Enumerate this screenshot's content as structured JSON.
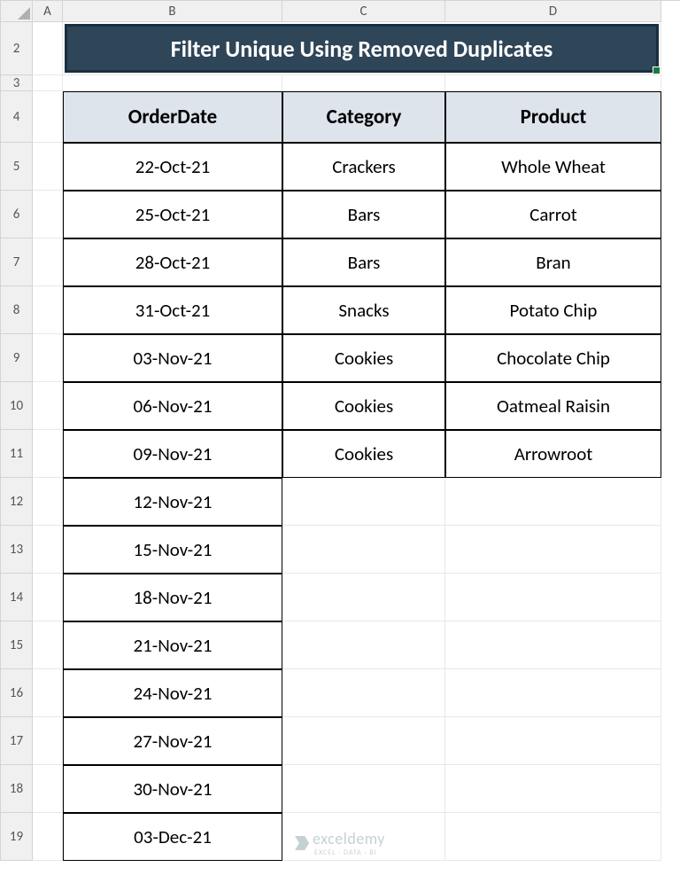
{
  "columns": [
    "A",
    "B",
    "C",
    "D"
  ],
  "rows": [
    "2",
    "3",
    "4",
    "5",
    "6",
    "7",
    "8",
    "9",
    "10",
    "11",
    "12",
    "13",
    "14",
    "15",
    "16",
    "17",
    "18",
    "19"
  ],
  "title": "Filter Unique Using Removed Duplicates",
  "headers": {
    "b": "OrderDate",
    "c": "Category",
    "d": "Product"
  },
  "data": {
    "dates": [
      "22-Oct-21",
      "25-Oct-21",
      "28-Oct-21",
      "31-Oct-21",
      "03-Nov-21",
      "06-Nov-21",
      "09-Nov-21",
      "12-Nov-21",
      "15-Nov-21",
      "18-Nov-21",
      "21-Nov-21",
      "24-Nov-21",
      "27-Nov-21",
      "30-Nov-21",
      "03-Dec-21"
    ],
    "categories": [
      "Crackers",
      "Bars",
      "Bars",
      "Snacks",
      "Cookies",
      "Cookies",
      "Cookies"
    ],
    "products": [
      "Whole Wheat",
      "Carrot",
      "Bran",
      "Potato Chip",
      "Chocolate Chip",
      "Oatmeal Raisin",
      "Arrowroot"
    ]
  },
  "watermark": {
    "brand": "exceldemy",
    "tag": "EXCEL · DATA · BI"
  }
}
